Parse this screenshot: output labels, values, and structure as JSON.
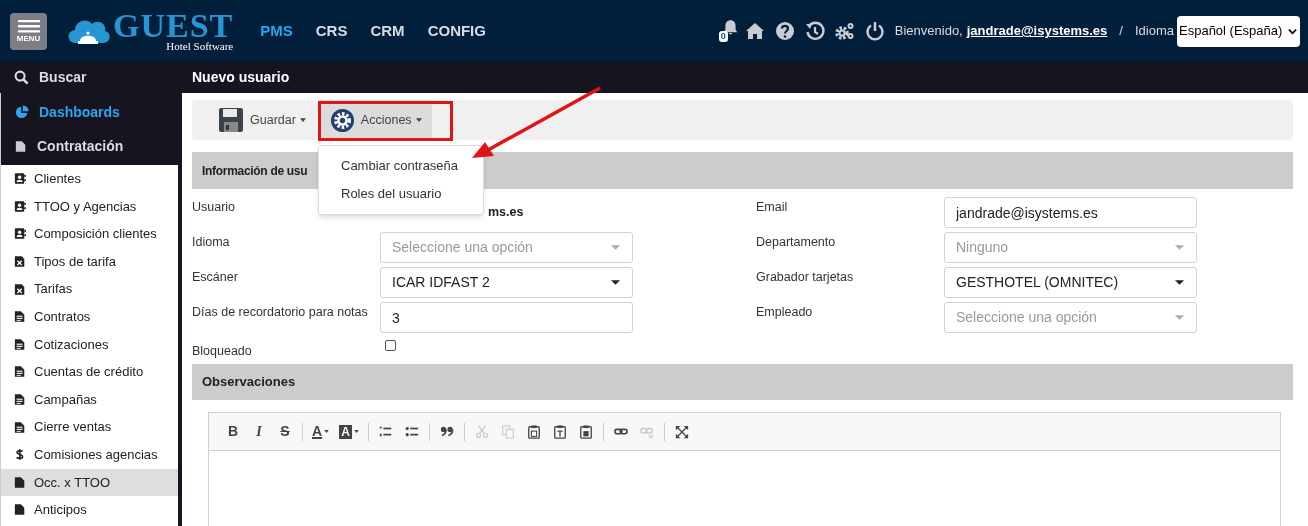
{
  "header": {
    "menu_label": "MENU",
    "logo_title": "GUEST",
    "logo_subtitle": "Hotel Software",
    "nav": [
      {
        "label": "PMS",
        "selected": true
      },
      {
        "label": "CRS",
        "selected": false
      },
      {
        "label": "CRM",
        "selected": false
      },
      {
        "label": "CONFIG",
        "selected": false
      }
    ],
    "notification_count": "0",
    "welcome": "Bienvenido,",
    "user": "jandrade@isystems.es",
    "separator": "/",
    "language_label": "Idioma",
    "language": "Español (España)"
  },
  "search": {
    "label": "Buscar"
  },
  "page_title": "Nuevo usuario",
  "sidebar": {
    "sections": [
      {
        "label": "Dashboards",
        "kind": "chart",
        "selected": true
      },
      {
        "label": "Contratación",
        "kind": "file",
        "selected": false
      }
    ],
    "items": [
      {
        "label": "Clientes",
        "kind": "card",
        "selected": false
      },
      {
        "label": "TTOO y Agencias",
        "kind": "card",
        "selected": false
      },
      {
        "label": "Composición clientes",
        "kind": "card",
        "selected": false
      },
      {
        "label": "Tipos de tarifa",
        "kind": "sheet",
        "selected": false
      },
      {
        "label": "Tarifas",
        "kind": "sheet",
        "selected": false
      },
      {
        "label": "Contratos",
        "kind": "doc",
        "selected": false
      },
      {
        "label": "Cotizaciones",
        "kind": "doc",
        "selected": false
      },
      {
        "label": "Cuentas de crédito",
        "kind": "doc",
        "selected": false
      },
      {
        "label": "Campañas",
        "kind": "doc",
        "selected": false
      },
      {
        "label": "Cierre ventas",
        "kind": "doc",
        "selected": false
      },
      {
        "label": "Comisiones agencias",
        "kind": "money",
        "selected": false
      },
      {
        "label": "Occ. x TTOO",
        "kind": "file",
        "selected": true
      },
      {
        "label": "Anticipos",
        "kind": "file",
        "selected": false
      }
    ]
  },
  "toolbar": {
    "buttons": [
      {
        "label": "Guardar",
        "kind": "save"
      },
      {
        "label": "Acciones",
        "kind": "actions"
      }
    ]
  },
  "actions_menu": {
    "items": [
      "Cambiar contraseña",
      "Roles del usuario"
    ]
  },
  "user_section": {
    "title": "Información de usu",
    "fields": [
      {
        "label": "Usuario",
        "kind": "static",
        "value": "ms.es"
      },
      {
        "label": "Email",
        "kind": "text",
        "value": "jandrade@isystems.es"
      },
      {
        "label": "Idioma",
        "kind": "select",
        "placeholder": "Seleccione una opción"
      },
      {
        "label": "Departamento",
        "kind": "select",
        "placeholder": "Ninguno"
      },
      {
        "label": "Escáner",
        "kind": "select",
        "value": "ICAR IDFAST 2"
      },
      {
        "label": "Grabador tarjetas",
        "kind": "select",
        "value": "GESTHOTEL (OMNITEC)"
      },
      {
        "label": "Días de recordatorio para notas",
        "kind": "text",
        "value": "3"
      },
      {
        "label": "Empleado",
        "kind": "select",
        "placeholder": "Seleccione una opción"
      },
      {
        "label": "Bloqueado",
        "kind": "checkbox",
        "checked": false
      }
    ]
  },
  "observations": {
    "title": "Observaciones",
    "editor_tools": [
      {
        "kind": "bold",
        "label": "B",
        "disabled": false
      },
      {
        "kind": "italic",
        "label": "I",
        "disabled": false
      },
      {
        "kind": "strike",
        "label": "S",
        "disabled": false
      },
      {
        "kind": "sep"
      },
      {
        "kind": "text-color",
        "label": "A",
        "disabled": false
      },
      {
        "kind": "bg-color",
        "label": "A",
        "disabled": false
      },
      {
        "kind": "sep"
      },
      {
        "kind": "ol",
        "disabled": false
      },
      {
        "kind": "ul",
        "disabled": false
      },
      {
        "kind": "sep"
      },
      {
        "kind": "quote",
        "disabled": false
      },
      {
        "kind": "sep"
      },
      {
        "kind": "cut",
        "disabled": true
      },
      {
        "kind": "copy",
        "disabled": true
      },
      {
        "kind": "paste",
        "disabled": false
      },
      {
        "kind": "paste-text",
        "disabled": false
      },
      {
        "kind": "paste-word",
        "disabled": false
      },
      {
        "kind": "sep"
      },
      {
        "kind": "link",
        "disabled": false
      },
      {
        "kind": "unlink",
        "disabled": true
      },
      {
        "kind": "sep"
      },
      {
        "kind": "maximize",
        "disabled": false
      }
    ]
  }
}
